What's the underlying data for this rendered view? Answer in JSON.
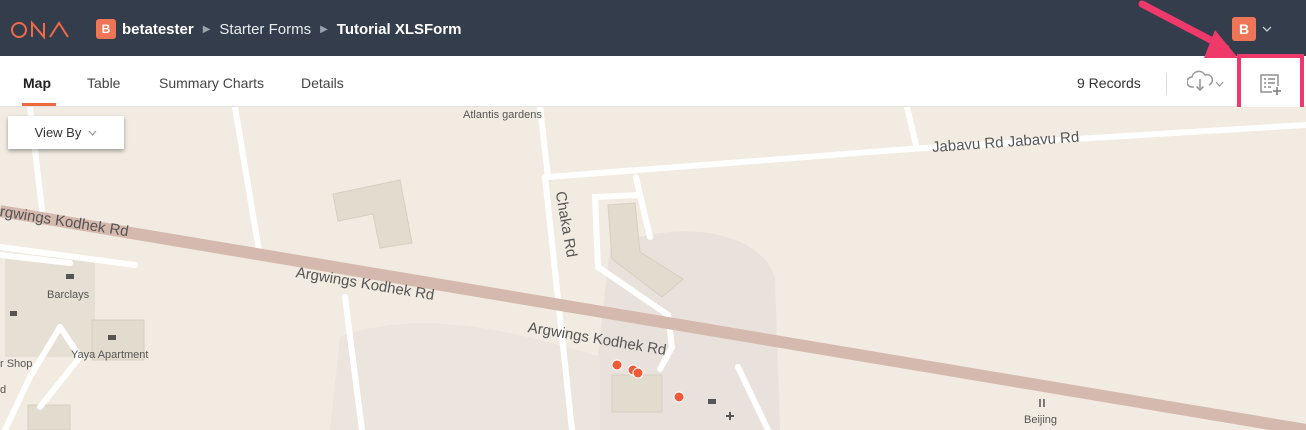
{
  "header": {
    "breadcrumb": {
      "avatar_letter": "B",
      "account": "betatester",
      "project": "Starter Forms",
      "form": "Tutorial XLSForm"
    },
    "user": {
      "avatar_letter": "B"
    }
  },
  "tabs": [
    {
      "label": "Map",
      "active": true
    },
    {
      "label": "Table",
      "active": false
    },
    {
      "label": "Summary Charts",
      "active": false
    },
    {
      "label": "Details",
      "active": false
    }
  ],
  "records_label": "9 Records",
  "icons": {
    "logo": "ona-logo",
    "download": "cloud-download-icon",
    "add_form": "add-record-icon"
  },
  "colors": {
    "topbar": "#343d4b",
    "accent": "#f0693f",
    "highlight": "#f0396b",
    "avatar": "#ef7557",
    "map_marker": "#ee5a3a"
  },
  "map": {
    "view_by_label": "View By",
    "places": {
      "atlantis": "Atlantis gardens",
      "barclays": "Barclays",
      "yaya": "Yaya Apartment",
      "shop": "r Shop",
      "d": "d",
      "beijing": "Beijing"
    },
    "roads": {
      "jabavu": "Jabavu Rd  Jabavu Rd",
      "chaka": "Chaka Rd",
      "argwings_1": "rgwings Kodhek Rd",
      "argwings_2": "Argwings Kodhek Rd",
      "argwings_3": "Argwings Kodhek Rd"
    }
  }
}
